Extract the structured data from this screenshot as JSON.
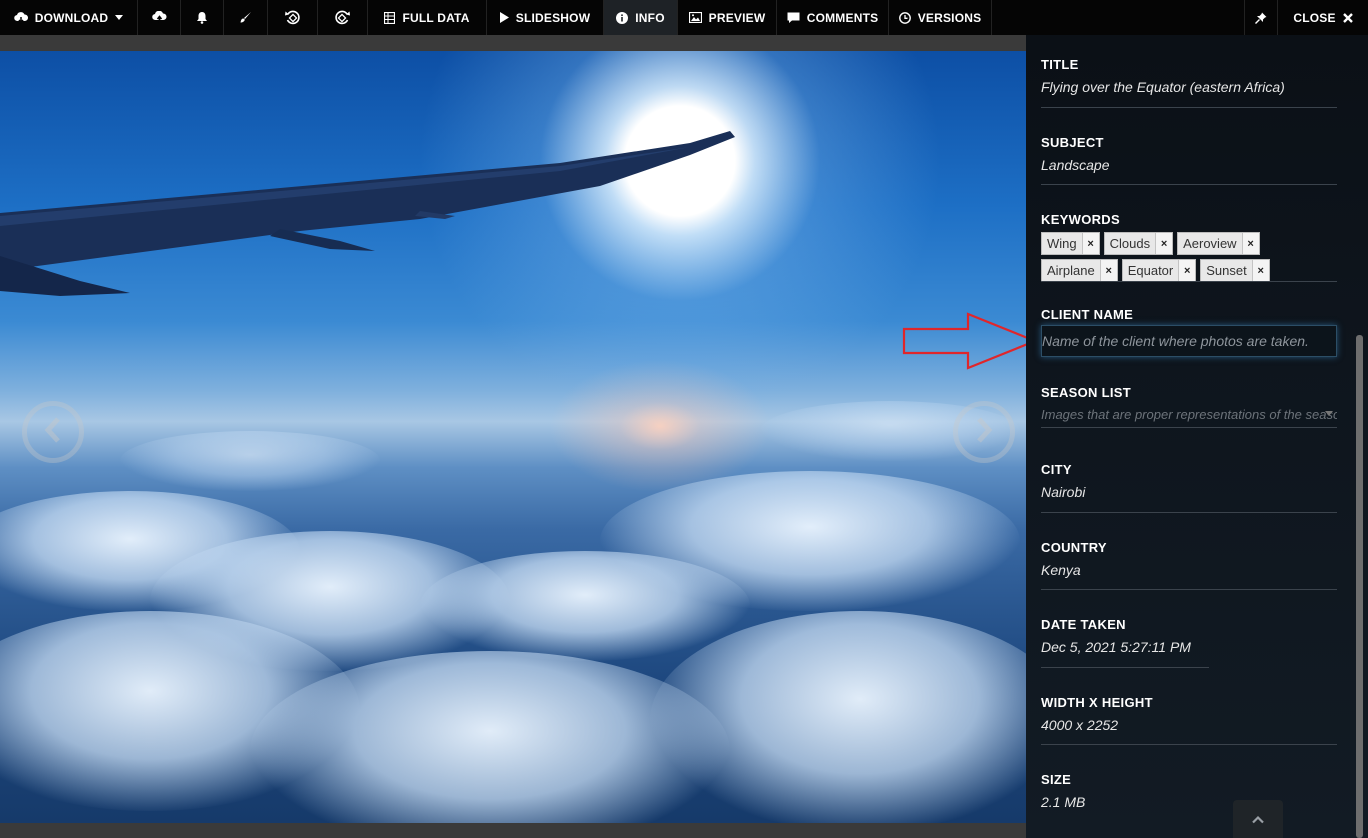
{
  "toolbar": {
    "download_label": "DOWNLOAD",
    "full_data_label": "FULL DATA",
    "slideshow_label": "SLIDESHOW",
    "info_label": "INFO",
    "preview_label": "PREVIEW",
    "comments_label": "COMMENTS",
    "versions_label": "VERSIONS",
    "close_label": "CLOSE"
  },
  "info": {
    "title": {
      "label": "TITLE",
      "value": "Flying over the Equator (eastern Africa)"
    },
    "subject": {
      "label": "SUBJECT",
      "value": "Landscape"
    },
    "keywords": {
      "label": "KEYWORDS",
      "tags": [
        "Wing",
        "Clouds",
        "Aeroview",
        "Airplane",
        "Equator",
        "Sunset"
      ],
      "remove_symbol": "×"
    },
    "client_name": {
      "label": "CLIENT NAME",
      "placeholder": "Name of the client where photos are taken."
    },
    "season_list": {
      "label": "SEASON LIST",
      "placeholder": "Images that are proper representations of the seaso"
    },
    "city": {
      "label": "CITY",
      "value": "Nairobi"
    },
    "country": {
      "label": "COUNTRY",
      "value": "Kenya"
    },
    "date_taken": {
      "label": "DATE TAKEN",
      "value": "Dec 5, 2021 5:27:11 PM"
    },
    "dimensions": {
      "label": "WIDTH X HEIGHT",
      "value": "4000 x 2252"
    },
    "size": {
      "label": "SIZE",
      "value": "2.1 MB"
    }
  },
  "colors": {
    "toolbar_bg": "#050505",
    "active_tab_bg": "#1e2226",
    "panel_bg": "#0e151d",
    "annotation_arrow": "#e0262b"
  },
  "icons": [
    "cloud-download-icon",
    "caret-down-icon",
    "cloud-upload-icon",
    "bell-icon",
    "brush-icon",
    "rotate-left-icon",
    "rotate-right-icon",
    "table-icon",
    "play-icon",
    "info-icon",
    "image-icon",
    "comment-icon",
    "clock-icon",
    "pin-icon",
    "close-icon",
    "chevron-left-icon",
    "chevron-right-icon",
    "chevron-up-icon"
  ]
}
